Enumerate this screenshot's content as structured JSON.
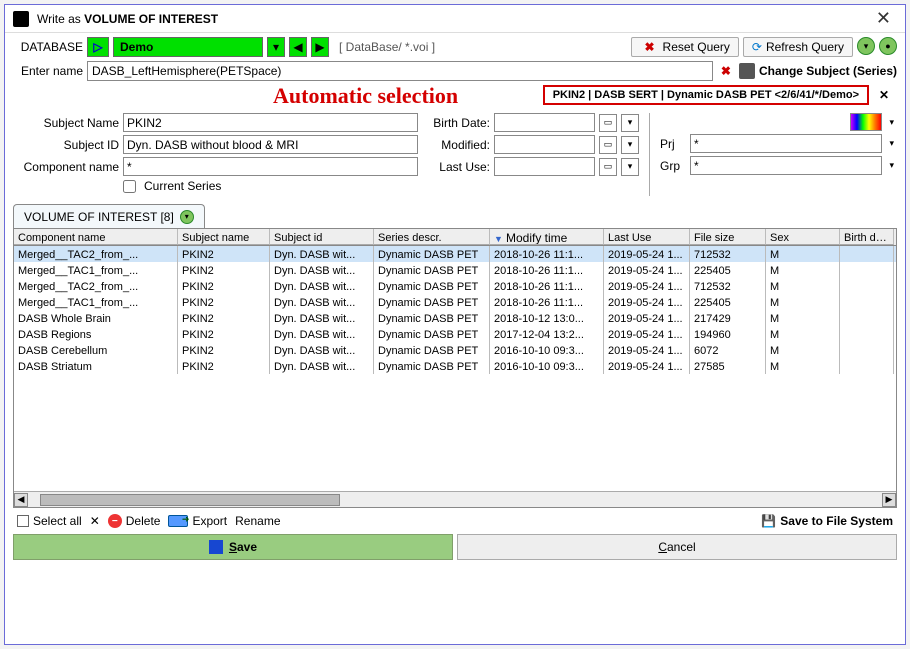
{
  "window": {
    "title_pre": "Write as ",
    "title_strong": "VOLUME OF INTEREST"
  },
  "database": {
    "label": "DATABASE",
    "name": "Demo",
    "path_hint": "[ DataBase/ *.voi ]",
    "reset_query": "Reset Query",
    "refresh_query": "Refresh Query"
  },
  "entername": {
    "label": "Enter name",
    "value": "DASB_LeftHemisphere(PETSpace)",
    "change_subject": "Change Subject (Series)"
  },
  "auto": {
    "label": "Automatic selection",
    "value": "PKIN2 | DASB SERT | Dynamic DASB PET <2/6/41/*/Demo>"
  },
  "form": {
    "subject_name_lbl": "Subject Name",
    "subject_name": "PKIN2",
    "subject_id_lbl": "Subject ID",
    "subject_id": "Dyn. DASB without blood & MRI",
    "component_lbl": "Component name",
    "component": "*",
    "current_series_lbl": "Current Series",
    "birth_date_lbl": "Birth Date:",
    "modified_lbl": "Modified:",
    "lastuse_lbl": "Last Use:",
    "prj_lbl": "Prj",
    "prj_val": "*",
    "grp_lbl": "Grp",
    "grp_val": "*"
  },
  "tab": {
    "label": "VOLUME OF INTEREST [8]"
  },
  "columns": [
    "Component name",
    "Subject name",
    "Subject id",
    "Series descr.",
    "Modify time",
    "Last Use",
    "File size",
    "Sex",
    "Birth date"
  ],
  "rows": [
    {
      "cn": "Merged__TAC2_from_...",
      "sn": "PKIN2",
      "sid": "Dyn. DASB wit...",
      "sd": "Dynamic DASB PET",
      "mt": "2018-10-26 11:1...",
      "lu": "2019-05-24 1...",
      "fs": "712532",
      "sex": "M",
      "bd": ""
    },
    {
      "cn": "Merged__TAC1_from_...",
      "sn": "PKIN2",
      "sid": "Dyn. DASB wit...",
      "sd": "Dynamic DASB PET",
      "mt": "2018-10-26 11:1...",
      "lu": "2019-05-24 1...",
      "fs": "225405",
      "sex": "M",
      "bd": ""
    },
    {
      "cn": "Merged__TAC2_from_...",
      "sn": "PKIN2",
      "sid": "Dyn. DASB wit...",
      "sd": "Dynamic DASB PET",
      "mt": "2018-10-26 11:1...",
      "lu": "2019-05-24 1...",
      "fs": "712532",
      "sex": "M",
      "bd": ""
    },
    {
      "cn": "Merged__TAC1_from_...",
      "sn": "PKIN2",
      "sid": "Dyn. DASB wit...",
      "sd": "Dynamic DASB PET",
      "mt": "2018-10-26 11:1...",
      "lu": "2019-05-24 1...",
      "fs": "225405",
      "sex": "M",
      "bd": ""
    },
    {
      "cn": "DASB Whole Brain",
      "sn": "PKIN2",
      "sid": "Dyn. DASB wit...",
      "sd": "Dynamic DASB PET",
      "mt": "2018-10-12 13:0...",
      "lu": "2019-05-24 1...",
      "fs": "217429",
      "sex": "M",
      "bd": ""
    },
    {
      "cn": "DASB Regions",
      "sn": "PKIN2",
      "sid": "Dyn. DASB wit...",
      "sd": "Dynamic DASB PET",
      "mt": "2017-12-04 13:2...",
      "lu": "2019-05-24 1...",
      "fs": "194960",
      "sex": "M",
      "bd": ""
    },
    {
      "cn": "DASB Cerebellum",
      "sn": "PKIN2",
      "sid": "Dyn. DASB wit...",
      "sd": "Dynamic DASB PET",
      "mt": "2016-10-10 09:3...",
      "lu": "2019-05-24 1...",
      "fs": "6072",
      "sex": "M",
      "bd": ""
    },
    {
      "cn": "DASB Striatum",
      "sn": "PKIN2",
      "sid": "Dyn. DASB wit...",
      "sd": "Dynamic DASB PET",
      "mt": "2016-10-10 09:3...",
      "lu": "2019-05-24 1...",
      "fs": "27585",
      "sex": "M",
      "bd": ""
    }
  ],
  "toolbar": {
    "select_all": "Select all",
    "delete": "Delete",
    "export": "Export",
    "rename": "Rename",
    "save_fs": "Save to File System"
  },
  "footer": {
    "save": "Save",
    "cancel": "Cancel"
  }
}
